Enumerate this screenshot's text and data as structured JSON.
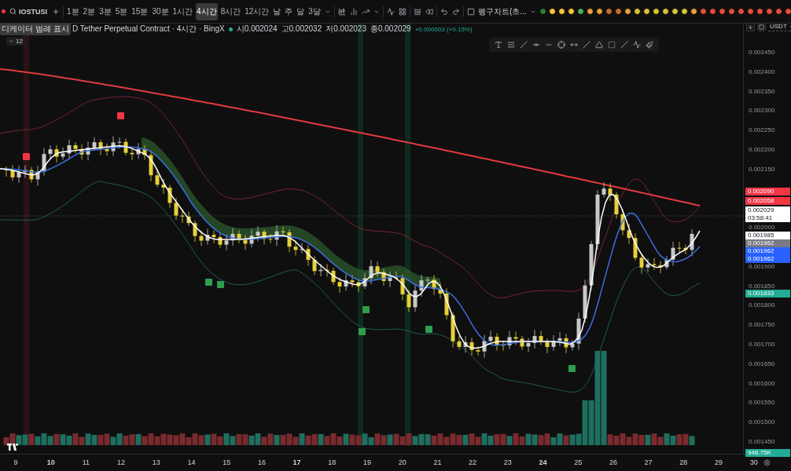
{
  "toolbar": {
    "symbol": "IOSTUSI",
    "timeframes": [
      {
        "label": "1분",
        "selected": false
      },
      {
        "label": "2분",
        "selected": false
      },
      {
        "label": "3분",
        "selected": false
      },
      {
        "label": "5분",
        "selected": false
      },
      {
        "label": "15분",
        "selected": false
      },
      {
        "label": "30분",
        "selected": false
      },
      {
        "label": "1시간",
        "selected": false
      },
      {
        "label": "4시간",
        "selected": true
      },
      {
        "label": "8시간",
        "selected": false
      },
      {
        "label": "12시간",
        "selected": false
      },
      {
        "label": "날",
        "selected": false
      },
      {
        "label": "주",
        "selected": false
      },
      {
        "label": "달",
        "selected": false
      },
      {
        "label": "3달",
        "selected": false
      }
    ],
    "template": "펭구차트(초..."
  },
  "legend": {
    "tooltip": "디케이터 범례 표시",
    "title": "D Tether Perpetual Contract · 4시간 · BingX",
    "ohlc": [
      {
        "label": "시",
        "value": "0.002024"
      },
      {
        "label": "고",
        "value": "0.002032"
      },
      {
        "label": "저",
        "value": "0.002023"
      },
      {
        "label": "종",
        "value": "0.002029"
      }
    ],
    "change": "+0.000003 (+0.15%)",
    "indicator_count": "12"
  },
  "price_scale": {
    "currency": "USDT",
    "ticks": [
      "0.002450",
      "0.002400",
      "0.002350",
      "0.002300",
      "0.002250",
      "0.002200",
      "0.002150",
      "0.002000",
      "0.001900",
      "0.001850",
      "0.001800",
      "0.001750",
      "0.001700",
      "0.001650",
      "0.001600",
      "0.001550",
      "0.001500",
      "0.001450"
    ],
    "tags": [
      {
        "text": "0.002090",
        "color": "#f23645"
      },
      {
        "text": "0.002058",
        "color": "#f23645"
      },
      {
        "text": "0.002029",
        "sub": "03:58:41",
        "color": "#ffffff"
      },
      {
        "text": "0.001985",
        "color": "#ffffff"
      },
      {
        "text": "0.001962",
        "color": "#787b86"
      },
      {
        "text": "0.001962",
        "color": "#2962ff"
      },
      {
        "text": "0.001962",
        "color": "#2962ff"
      },
      {
        "text": "0.001833",
        "color": "#22ab94"
      }
    ],
    "volume_tag": "946.75K"
  },
  "time_scale": {
    "ticks": [
      {
        "label": "9",
        "bold": false
      },
      {
        "label": "10",
        "bold": true
      },
      {
        "label": "11",
        "bold": false
      },
      {
        "label": "12",
        "bold": false
      },
      {
        "label": "13",
        "bold": false
      },
      {
        "label": "14",
        "bold": false
      },
      {
        "label": "15",
        "bold": false
      },
      {
        "label": "16",
        "bold": false
      },
      {
        "label": "17",
        "bold": true
      },
      {
        "label": "18",
        "bold": false
      },
      {
        "label": "19",
        "bold": false
      },
      {
        "label": "20",
        "bold": false
      },
      {
        "label": "21",
        "bold": false
      },
      {
        "label": "22",
        "bold": false
      },
      {
        "label": "23",
        "bold": false
      },
      {
        "label": "24",
        "bold": true
      },
      {
        "label": "25",
        "bold": false
      },
      {
        "label": "26",
        "bold": false
      },
      {
        "label": "27",
        "bold": false
      },
      {
        "label": "28",
        "bold": false
      },
      {
        "label": "29",
        "bold": false
      },
      {
        "label": "30",
        "bold": false
      }
    ]
  }
}
